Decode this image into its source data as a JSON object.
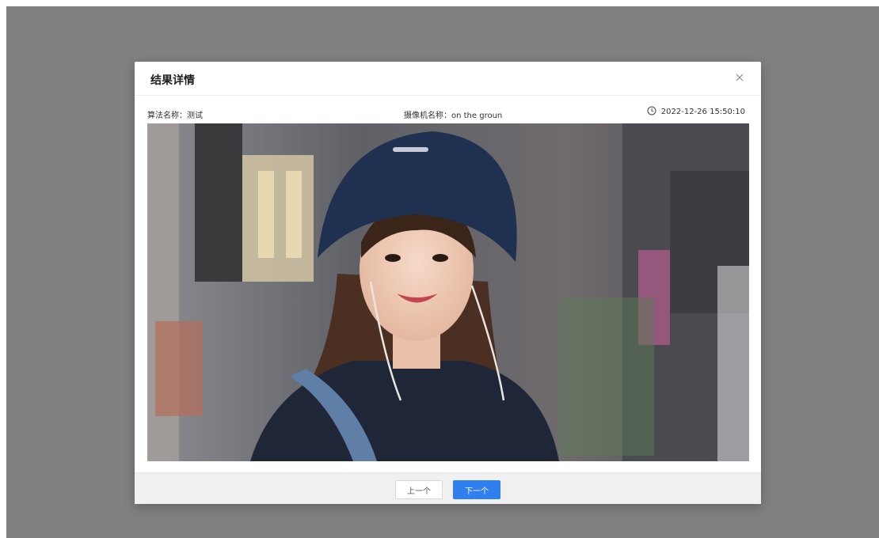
{
  "colors": {
    "mask": "#808080",
    "modal_bg": "#ffffff",
    "footer_bg": "#f0f0f0",
    "primary": "#2f7ff0"
  },
  "modal": {
    "title": "结果详情",
    "close_icon": "close-icon"
  },
  "info": {
    "algorithm": "算法名称：测试",
    "camera": "摄像机名称：on the groun",
    "time_icon": "clock-icon",
    "timestamp": "2022-12-26 15:50:10"
  },
  "footer": {
    "prev_label": "上一个",
    "next_label": "下一个"
  }
}
